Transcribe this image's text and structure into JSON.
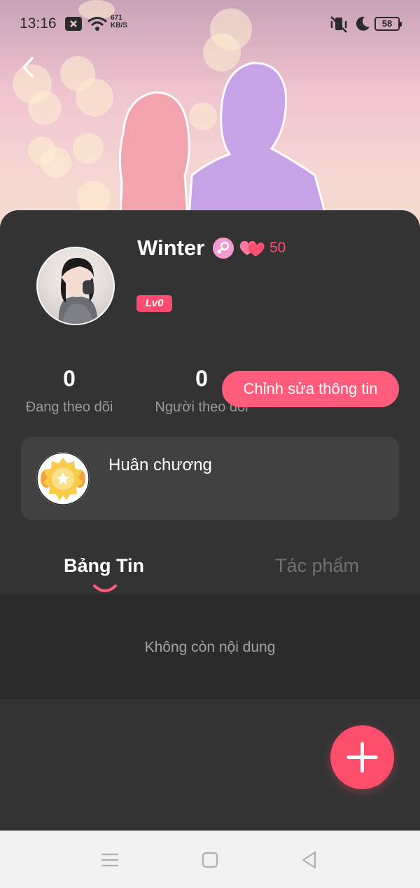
{
  "status_bar": {
    "time": "13:16",
    "net_speed_value": "671",
    "net_speed_unit": "KB/S",
    "battery": "58"
  },
  "profile": {
    "username": "Winter",
    "hearts_count": "50",
    "level": "Lv0"
  },
  "stats": {
    "following_count": "0",
    "following_label": "Đang theo dõi",
    "followers_count": "0",
    "followers_label": "Người theo dõi"
  },
  "edit_button_label": "Chỉnh sửa thông tin",
  "medal": {
    "label": "Huân chương"
  },
  "tabs": [
    {
      "label": "Bảng Tin",
      "active": true
    },
    {
      "label": "Tác phẩm",
      "active": false
    }
  ],
  "feed": {
    "empty_text": "Không còn nội dung"
  },
  "colors": {
    "accent": "#ff5b7b",
    "card_bg": "#333333",
    "badge_bg": "#ff4b6e"
  },
  "icons": [
    "back-arrow-icon",
    "gender-female-icon",
    "hearts-icon",
    "medal-icon",
    "plus-icon",
    "menu-icon",
    "home-icon",
    "back-triangle-icon"
  ]
}
